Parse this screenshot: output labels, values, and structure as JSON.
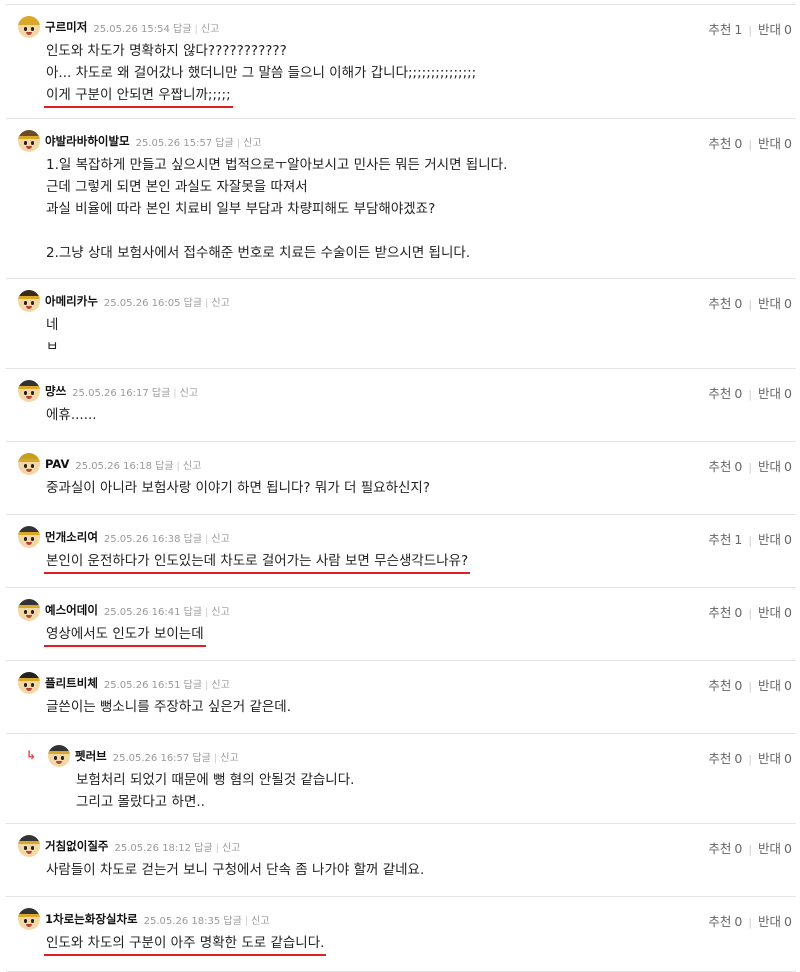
{
  "ui": {
    "reply": "답글",
    "report": "신고",
    "up_label": "추천",
    "down_label": "반대"
  },
  "comments": [
    {
      "nick": "구르미저",
      "date": "25.05.26 15:54",
      "up": "1",
      "down": "0",
      "lines": [
        "인도와 차도가 명확하지 않다???????????",
        "아... 차도로 왜 걸어갔나 했더니만 그 말씀 들으니 이해가 갑니다;;;;;;;;;;;;;;;",
        "이게 구분이 안되면 우짭니까;;;;;"
      ]
    },
    {
      "nick": "야발라바하이발모",
      "date": "25.05.26 15:57",
      "up": "0",
      "down": "0",
      "lines": [
        "1.일 복잡하게 만들고 싶으시면 법적으로ㅜ알아보시고 민사든 뭐든 거시면 됩니다.",
        "근데 그렇게 되면 본인 과실도 자잘못을 따져서",
        "과실 비율에 따라 본인 치료비 일부 부담과 차량피해도 부담해야겠죠?",
        "",
        "2.그냥 상대 보험사에서 접수해준 번호로 치료든 수술이든 받으시면 됩니다."
      ]
    },
    {
      "nick": "아메리카누",
      "date": "25.05.26 16:05",
      "up": "0",
      "down": "0",
      "lines": [
        "네",
        "ㅂ"
      ]
    },
    {
      "nick": "먕쓰",
      "date": "25.05.26 16:17",
      "up": "0",
      "down": "0",
      "lines": [
        "에휴......"
      ]
    },
    {
      "nick": "PAV",
      "date": "25.05.26 16:18",
      "up": "0",
      "down": "0",
      "lines": [
        "중과실이 아니라 보험사랑 이야기 하면 됩니다? 뭐가 더 필요하신지?"
      ]
    },
    {
      "nick": "먼개소리여",
      "date": "25.05.26 16:38",
      "up": "1",
      "down": "0",
      "lines": [
        "본인이 운전하다가 인도있는데 차도로 걸어가는 사람 보면 무슨생각드나유?"
      ]
    },
    {
      "nick": "예스어데이",
      "date": "25.05.26 16:41",
      "up": "0",
      "down": "0",
      "lines": [
        "영상에서도 인도가 보이는데"
      ]
    },
    {
      "nick": "플리트비체",
      "date": "25.05.26 16:51",
      "up": "0",
      "down": "0",
      "lines": [
        "글쓴이는 뻥소니를 주장하고 싶은거 같은데."
      ]
    },
    {
      "nick": "펫러브",
      "date": "25.05.26 16:57",
      "up": "0",
      "down": "0",
      "lines": [
        "보험처리 되었기 때문에 뻥 혐의 안될것 같습니다.",
        "그리고 몰랐다고 하면.."
      ]
    },
    {
      "nick": "거침없이질주",
      "date": "25.05.26 18:12",
      "up": "0",
      "down": "0",
      "lines": [
        "사람들이 차도로 걷는거 보니 구청에서 단속 좀 나가야 할꺼 같네요."
      ]
    },
    {
      "nick": "1차로는화장실차로",
      "date": "25.05.26 18:35",
      "up": "0",
      "down": "0",
      "lines": [
        "인도와 차도의 구분이 아주 명확한 도로 같습니다."
      ]
    }
  ],
  "colors": {
    "highlight": "#e02020",
    "reply_arrow": "#f04444"
  }
}
